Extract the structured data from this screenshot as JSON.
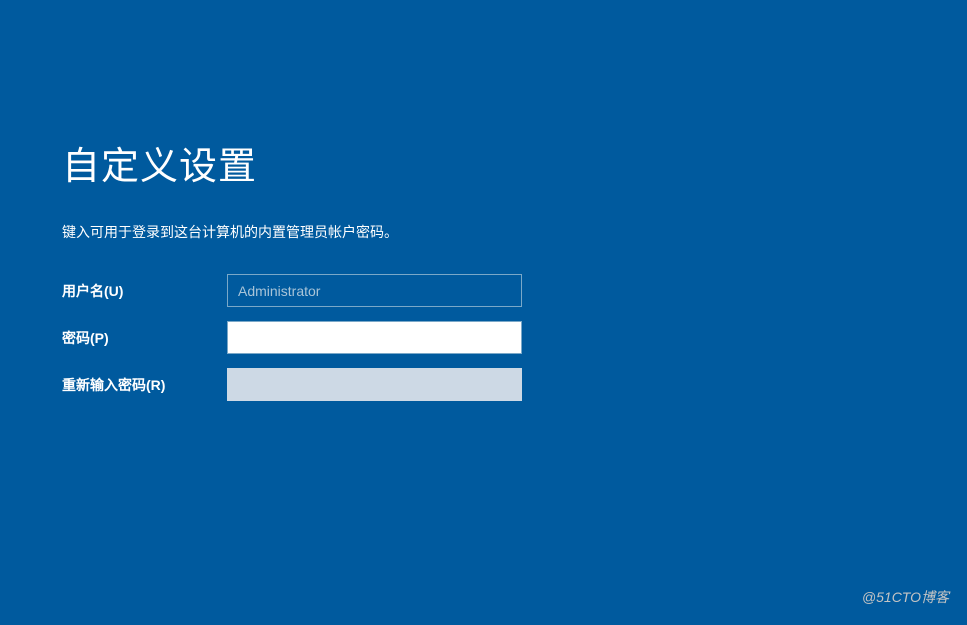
{
  "page": {
    "title": "自定义设置",
    "instruction": "键入可用于登录到这台计算机的内置管理员帐户密码。"
  },
  "form": {
    "username_label": "用户名(U)",
    "username_value": "Administrator",
    "password_label": "密码(P)",
    "password_value": "",
    "confirm_password_label": "重新输入密码(R)",
    "confirm_password_value": ""
  },
  "watermark": "@51CTO博客"
}
